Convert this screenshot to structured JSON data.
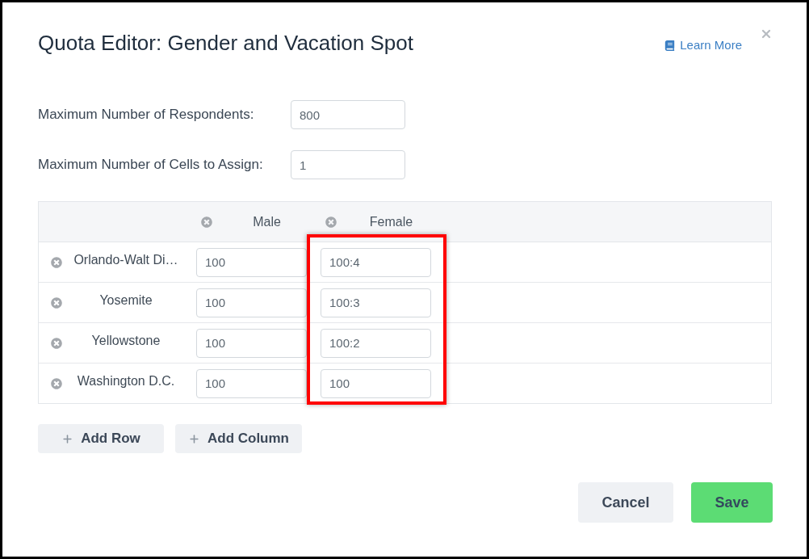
{
  "dialog": {
    "title": "Quota Editor: Gender and Vacation Spot",
    "help_link": "Learn More"
  },
  "fields": [
    {
      "label": "Maximum Number of Respondents:",
      "value": "800"
    },
    {
      "label": "Maximum Number of Cells to Assign:",
      "value": "1"
    }
  ],
  "quota_table": {
    "columns": [
      {
        "label": "Male",
        "highlighted": false
      },
      {
        "label": "Female",
        "highlighted": true
      }
    ],
    "rows": [
      {
        "label": "Orlando-Walt Di…",
        "values": [
          "100",
          "100:4"
        ]
      },
      {
        "label": "Yosemite",
        "values": [
          "100",
          "100:3"
        ]
      },
      {
        "label": "Yellowstone",
        "values": [
          "100",
          "100:2"
        ]
      },
      {
        "label": "Washington D.C.",
        "values": [
          "100",
          "100"
        ]
      }
    ]
  },
  "table_actions": [
    "Add Row",
    "Add Column"
  ],
  "buttons": [
    {
      "label": "Cancel",
      "kind": "secondary"
    },
    {
      "label": "Save",
      "kind": "primary"
    }
  ]
}
